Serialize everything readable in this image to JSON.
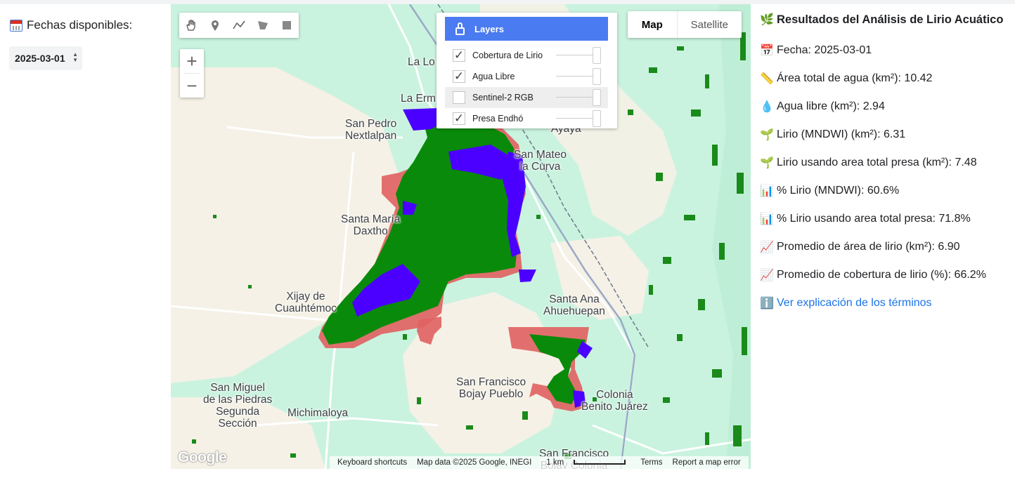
{
  "left_panel": {
    "dates_title": "Fechas disponibles:",
    "date_value": "2025-03-01"
  },
  "map": {
    "draw_tools": [
      "hand-icon",
      "marker-icon",
      "polyline-icon",
      "polygon-icon",
      "rectangle-icon"
    ],
    "zoom_in": "+",
    "zoom_out": "−",
    "map_type": {
      "map": "Map",
      "satellite": "Satellite",
      "selected": "Map"
    },
    "layers": {
      "title": "Layers",
      "items": [
        {
          "label": "Cobertura de Lirio",
          "checked": "✓"
        },
        {
          "label": "Agua Libre",
          "checked": "✓"
        },
        {
          "label": "Sentinel-2 RGB",
          "checked": ""
        },
        {
          "label": "Presa Endhó",
          "checked": "✓"
        }
      ]
    },
    "places": [
      "La Lo",
      "La Erm",
      "San Pedro\nNextlalpan",
      "Santa María\nAyaya",
      "San Mateo\nla Curva",
      "Santa María\nDaxtho",
      "Xijay de\nCuauhtémoc",
      "Santa Ana\nAhuehuepan",
      "San Francisco\nBojay Pueblo",
      "Colonia\nBenito Juárez",
      "San Miguel\nde las Piedras\nSegunda\nSección",
      "Michimaloya",
      "San Francisco\nBojay Colonia"
    ],
    "logo": "Google",
    "attribution": {
      "shortcuts": "Keyboard shortcuts",
      "data": "Map data ©2025 Google, INEGI",
      "scale": "1 km",
      "terms": "Terms",
      "report": "Report a map error"
    },
    "colors": {
      "lirio": "#008000",
      "agua_libre": "#4b00ff",
      "presa": "#ff0000",
      "background": "#c9f3df"
    }
  },
  "results": {
    "title": "Resultados del Análisis de Lirio Acuático",
    "lines": [
      {
        "icon": "📅",
        "text": "Fecha: 2025-03-01"
      },
      {
        "icon": "📏",
        "text": "Área total de agua (km²): 10.42"
      },
      {
        "icon": "💧",
        "text": "Agua libre (km²): 2.94"
      },
      {
        "icon": "🌱",
        "text": "Lirio (MNDWI) (km²): 6.31"
      },
      {
        "icon": "🌱",
        "text": "Lirio usando area total presa (km²): 7.48"
      },
      {
        "icon": "📊",
        "text": "% Lirio (MNDWI): 60.6%"
      },
      {
        "icon": "📊",
        "text": "% Lirio usando area total presa: 71.8%"
      },
      {
        "icon": "📈",
        "text": "Promedio de área de lirio (km²): 6.90"
      },
      {
        "icon": "📈",
        "text": "Promedio de cobertura de lirio (%): 66.2%"
      }
    ],
    "link": {
      "icon": "ℹ️",
      "text": "Ver explicación de los términos"
    }
  }
}
